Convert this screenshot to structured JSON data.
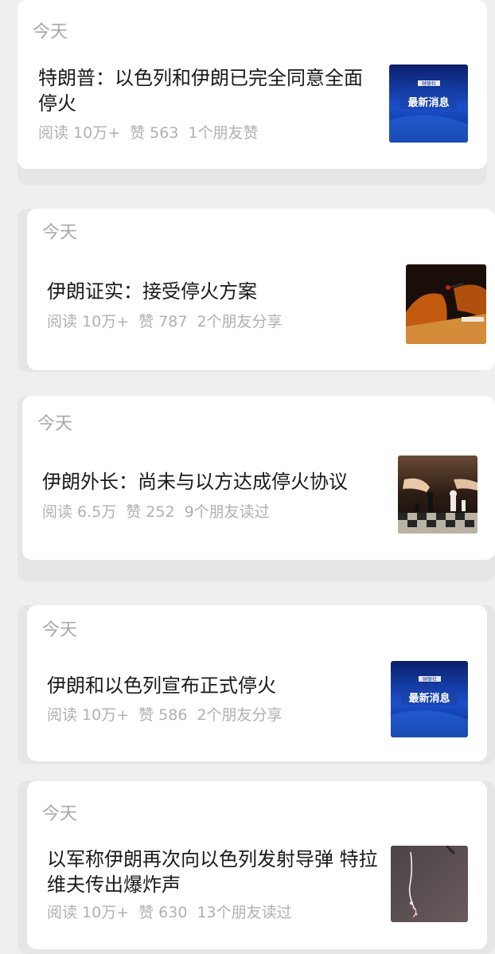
{
  "feed": {
    "items": [
      {
        "date": "今天",
        "title": "特朗普：以色列和伊朗已完全同意全面停火",
        "reads": "阅读 10万+",
        "likes": "赞 563",
        "social": "1个朋友赞",
        "thumbnail": {
          "kind": "news-banner",
          "brand": "财联社",
          "text": "最新消息"
        }
      },
      {
        "date": "今天",
        "title": "伊朗证实：接受停火方案",
        "reads": "阅读 10万+",
        "likes": "赞 787",
        "social": "2个朋友分享",
        "thumbnail": {
          "kind": "conference-chairs-photo"
        }
      },
      {
        "date": "今天",
        "title": "伊朗外长：尚未与以方达成停火协议",
        "reads": "阅读 6.5万",
        "likes": "赞 252",
        "social": "9个朋友读过",
        "thumbnail": {
          "kind": "chess-photo"
        }
      },
      {
        "date": "今天",
        "title": "伊朗和以色列宣布正式停火",
        "reads": "阅读 10万+",
        "likes": "赞 586",
        "social": "2个朋友分享",
        "thumbnail": {
          "kind": "news-banner",
          "brand": "财联社",
          "text": "最新消息"
        }
      },
      {
        "date": "今天",
        "title": "以军称伊朗再次向以色列发射导弹 特拉维夫传出爆炸声",
        "reads": "阅读 10万+",
        "likes": "赞 630",
        "social": "13个朋友读过",
        "thumbnail": {
          "kind": "missile-sky-photo"
        }
      }
    ]
  }
}
